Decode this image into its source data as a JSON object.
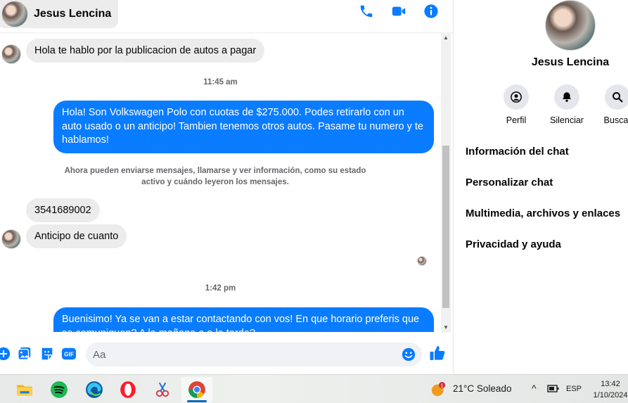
{
  "header": {
    "contact_name": "Jesus Lencina",
    "icons": [
      "phone-icon",
      "video-call-icon",
      "info-icon"
    ]
  },
  "colors": {
    "accent": "#0a7cff",
    "incoming_bubble": "#ececec",
    "muted_text": "#65676b"
  },
  "messages": {
    "m1": "Hola te hablo por la publicacion de autos a pagar",
    "t1": "11:45 am",
    "m2": "Hola! Son Volkswagen Polo con cuotas de $275.000. Podes retirarlo con un auto usado o un anticipo! Tambien tenemos otros autos. Pasame tu numero y te hablamos!",
    "note": "Ahora pueden enviarse mensajes, llamarse y ver información, como su estado activo y cuándo leyeron los mensajes.",
    "m3": "3541689002",
    "m4": "Anticipo de cuanto",
    "t2": "1:42 pm",
    "m5": "Buenisimo! Ya se van a estar contactando con vos! En que horario preferis que se comuniquen? A la mañana o a la tarde?"
  },
  "composer": {
    "placeholder": "Aa",
    "icons": [
      "plus-icon",
      "gallery-icon",
      "sticker-icon",
      "gif-icon",
      "emoji-icon",
      "like-icon"
    ],
    "gif_label": "GIF"
  },
  "info_panel": {
    "name": "Jesus Lencina",
    "actions": [
      {
        "label": "Perfil",
        "icon": "profile-icon"
      },
      {
        "label": "Silenciar",
        "icon": "bell-icon"
      },
      {
        "label": "Buscar",
        "icon": "search-icon"
      }
    ],
    "menu": [
      "Información del chat",
      "Personalizar chat",
      "Multimedia, archivos y enlaces",
      "Privacidad y ayuda"
    ]
  },
  "taskbar": {
    "apps": [
      "file-explorer-icon",
      "spotify-icon",
      "edge-icon",
      "opera-icon",
      "snipping-tool-icon",
      "chrome-icon"
    ],
    "weather_badge": "1",
    "weather": "21°C  Soleado",
    "chevron": "^",
    "language": "ESP",
    "time": "13:42",
    "date": "1/10/2024"
  }
}
